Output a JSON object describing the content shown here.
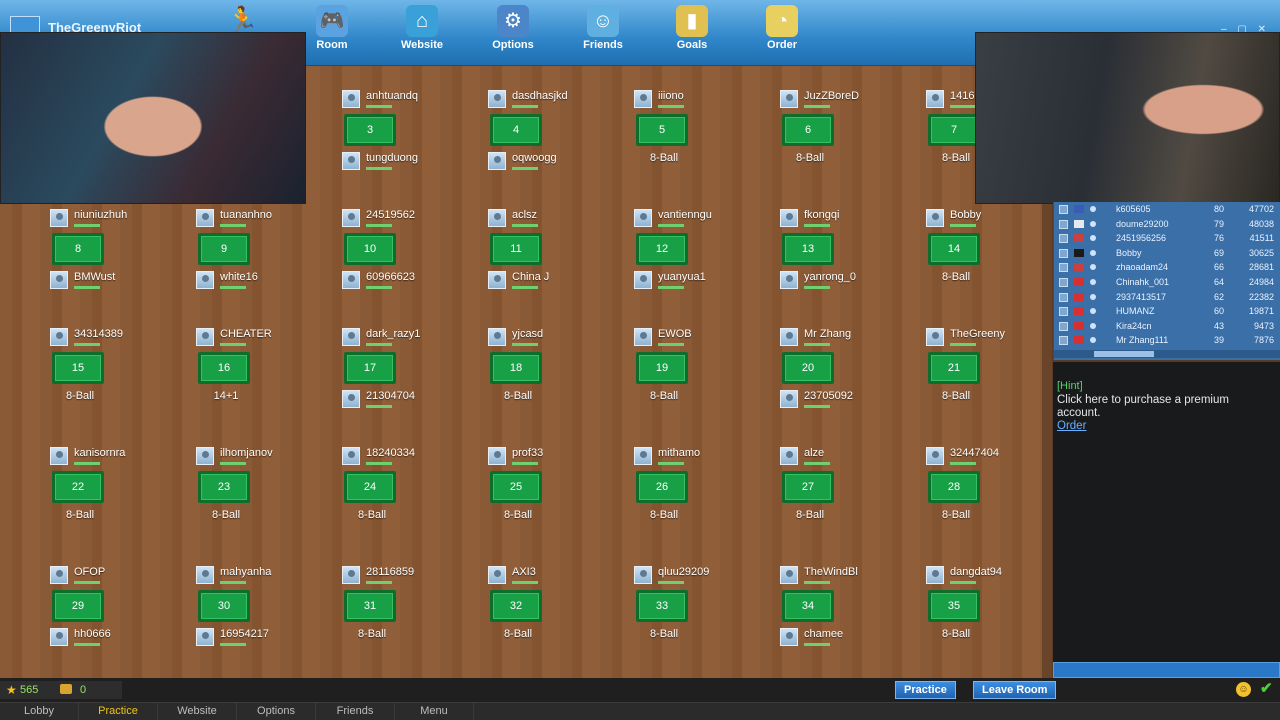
{
  "app": {
    "title": "TheGreenyRiot"
  },
  "nav": [
    {
      "label": "Room",
      "icon": "gamepad-icon"
    },
    {
      "label": "Website",
      "icon": "house-icon"
    },
    {
      "label": "Options",
      "icon": "gear-icon"
    },
    {
      "label": "Friends",
      "icon": "friends-icon"
    },
    {
      "label": "Goals",
      "icon": "trophy-icon"
    },
    {
      "label": "Order",
      "icon": "cart-icon"
    }
  ],
  "tables": [
    {
      "number": "3",
      "top_player": "anhtuandq",
      "bottom_player": "tungduong",
      "game_type": ""
    },
    {
      "number": "4",
      "top_player": "dasdhasjkd",
      "bottom_player": "oqwoogg",
      "game_type": ""
    },
    {
      "number": "5",
      "top_player": "iiiono",
      "bottom_player": "",
      "game_type": "8-Ball"
    },
    {
      "number": "6",
      "top_player": "JuzZBoreD",
      "bottom_player": "",
      "game_type": "8-Ball"
    },
    {
      "number": "7",
      "top_player": "1416",
      "bottom_player": "",
      "game_type": "8-Ball"
    },
    {
      "number": "8",
      "top_player": "niuniuzhuh",
      "bottom_player": "BMWust",
      "game_type": ""
    },
    {
      "number": "9",
      "top_player": "tuananhno",
      "bottom_player": "white16",
      "game_type": ""
    },
    {
      "number": "10",
      "top_player": "24519562",
      "bottom_player": "60966623",
      "game_type": ""
    },
    {
      "number": "11",
      "top_player": "aclsz",
      "bottom_player": "China J",
      "game_type": ""
    },
    {
      "number": "12",
      "top_player": "vantienngu",
      "bottom_player": "yuanyua1",
      "game_type": ""
    },
    {
      "number": "13",
      "top_player": "fkongqi",
      "bottom_player": "yanrong_0",
      "game_type": ""
    },
    {
      "number": "14",
      "top_player": "Bobby",
      "bottom_player": "",
      "game_type": "8-Ball"
    },
    {
      "number": "15",
      "top_player": "34314389",
      "bottom_player": "",
      "game_type": "8-Ball"
    },
    {
      "number": "16",
      "top_player": "CHEATER",
      "bottom_player": "",
      "game_type": "14+1"
    },
    {
      "number": "17",
      "top_player": "dark_razy1",
      "bottom_player": "21304704",
      "game_type": ""
    },
    {
      "number": "18",
      "top_player": "yjcasd",
      "bottom_player": "",
      "game_type": "8-Ball"
    },
    {
      "number": "19",
      "top_player": "EWOB",
      "bottom_player": "",
      "game_type": "8-Ball"
    },
    {
      "number": "20",
      "top_player": "Mr Zhang",
      "bottom_player": "23705092",
      "game_type": ""
    },
    {
      "number": "21",
      "top_player": "TheGreeny",
      "bottom_player": "",
      "game_type": "8-Ball"
    },
    {
      "number": "22",
      "top_player": "kanisornra",
      "bottom_player": "",
      "game_type": "8-Ball"
    },
    {
      "number": "23",
      "top_player": "ilhomjanov",
      "bottom_player": "",
      "game_type": "8-Ball"
    },
    {
      "number": "24",
      "top_player": "18240334",
      "bottom_player": "",
      "game_type": "8-Ball"
    },
    {
      "number": "25",
      "top_player": "prof33",
      "bottom_player": "",
      "game_type": "8-Ball"
    },
    {
      "number": "26",
      "top_player": "mithamo",
      "bottom_player": "",
      "game_type": "8-Ball"
    },
    {
      "number": "27",
      "top_player": "alze",
      "bottom_player": "",
      "game_type": "8-Ball"
    },
    {
      "number": "28",
      "top_player": "32447404",
      "bottom_player": "",
      "game_type": "8-Ball"
    },
    {
      "number": "29",
      "top_player": "OFOP",
      "bottom_player": "hh0666",
      "game_type": ""
    },
    {
      "number": "30",
      "top_player": "mahyanha",
      "bottom_player": "16954217",
      "game_type": ""
    },
    {
      "number": "31",
      "top_player": "28116859",
      "bottom_player": "",
      "game_type": "8-Ball"
    },
    {
      "number": "32",
      "top_player": "AXI3",
      "bottom_player": "",
      "game_type": "8-Ball"
    },
    {
      "number": "33",
      "top_player": "qluu29209",
      "bottom_player": "",
      "game_type": "8-Ball"
    },
    {
      "number": "34",
      "top_player": "TheWindBl",
      "bottom_player": "chamee",
      "game_type": ""
    },
    {
      "number": "35",
      "top_player": "dangdat94",
      "bottom_player": "",
      "game_type": "8-Ball"
    }
  ],
  "ranking": [
    {
      "name": "k605605",
      "level": "80",
      "score": "47702"
    },
    {
      "name": "doume29200",
      "level": "79",
      "score": "48038"
    },
    {
      "name": "2451956256",
      "level": "76",
      "score": "41511"
    },
    {
      "name": "Bobby",
      "level": "69",
      "score": "30625"
    },
    {
      "name": "zhaoadam24",
      "level": "66",
      "score": "28681"
    },
    {
      "name": "Chinahk_001",
      "level": "64",
      "score": "24984"
    },
    {
      "name": "2937413517",
      "level": "62",
      "score": "22382"
    },
    {
      "name": "HUMANZ",
      "level": "60",
      "score": "19871"
    },
    {
      "name": "Kira24cn",
      "level": "43",
      "score": "9473"
    },
    {
      "name": "Mr Zhang111",
      "level": "39",
      "score": "7876"
    }
  ],
  "hint": {
    "title": "[Hint]",
    "text": "Click here to purchase a premium account.",
    "link": "Order"
  },
  "status": {
    "coins": "565",
    "cash": "0"
  },
  "actions": {
    "practice": "Practice",
    "leave_room": "Leave Room"
  },
  "tabs": [
    {
      "label": "Lobby",
      "active": false
    },
    {
      "label": "Practice",
      "active": true
    },
    {
      "label": "Website",
      "active": false
    },
    {
      "label": "Options",
      "active": false
    },
    {
      "label": "Friends",
      "active": false
    },
    {
      "label": "Menu",
      "active": false
    }
  ],
  "colors": {
    "accent": "#2f86c9",
    "table_felt": "#17a045",
    "active_tab": "#f0c419"
  }
}
